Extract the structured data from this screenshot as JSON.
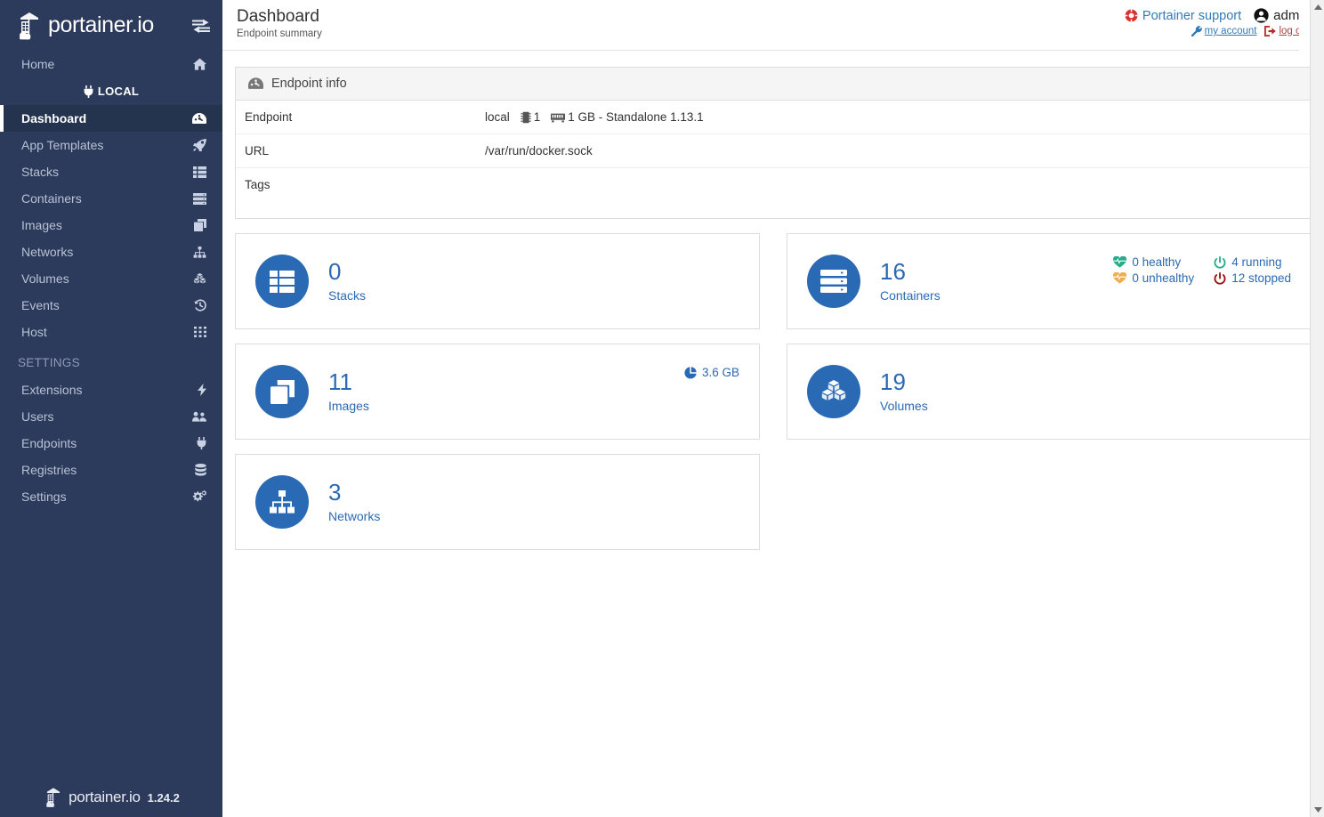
{
  "sidebar": {
    "brand": {
      "name": "portainer.io",
      "toggle_icon": "toggle-sidebar-icon",
      "logo_icon": "portainer-logo-icon"
    },
    "home": {
      "label": "Home",
      "icon": "home-icon"
    },
    "environment": {
      "label": "LOCAL",
      "icon": "plug-icon"
    },
    "items": [
      {
        "label": "Dashboard",
        "icon": "dashboard-icon",
        "active": true
      },
      {
        "label": "App Templates",
        "icon": "rocket-icon",
        "active": false
      },
      {
        "label": "Stacks",
        "icon": "list-icon",
        "active": false
      },
      {
        "label": "Containers",
        "icon": "server-icon",
        "active": false
      },
      {
        "label": "Images",
        "icon": "clone-icon",
        "active": false
      },
      {
        "label": "Networks",
        "icon": "sitemap-icon",
        "active": false
      },
      {
        "label": "Volumes",
        "icon": "cubes-icon",
        "active": false
      },
      {
        "label": "Events",
        "icon": "history-icon",
        "active": false
      },
      {
        "label": "Host",
        "icon": "th-icon",
        "active": false
      }
    ],
    "settings_title": "SETTINGS",
    "settings_items": [
      {
        "label": "Extensions",
        "icon": "bolt-icon"
      },
      {
        "label": "Users",
        "icon": "users-icon"
      },
      {
        "label": "Endpoints",
        "icon": "plug-icon"
      },
      {
        "label": "Registries",
        "icon": "database-icon"
      },
      {
        "label": "Settings",
        "icon": "cogs-icon"
      }
    ],
    "footer": {
      "name": "portainer.io",
      "version": "1.24.2",
      "logo_icon": "portainer-logo-icon"
    }
  },
  "header": {
    "title": "Dashboard",
    "subtitle": "Endpoint summary",
    "support_label": "Portainer support",
    "support_icon": "life-ring-icon",
    "username": "admin",
    "user_icon": "user-circle-icon",
    "my_account_label": "my account",
    "my_account_icon": "wrench-icon",
    "log_out_label": "log out",
    "log_out_icon": "sign-out-icon"
  },
  "endpoint_info": {
    "panel_title": "Endpoint info",
    "panel_icon": "tachometer-icon",
    "rows": [
      {
        "key": "Endpoint",
        "value": "local",
        "cpu_icon": "microchip-icon",
        "cpu": "1",
        "mem_icon": "memory-icon",
        "mem": "1 GB - Standalone 1.13.1"
      },
      {
        "key": "URL",
        "value": "/var/run/docker.sock"
      },
      {
        "key": "Tags",
        "value": ""
      }
    ]
  },
  "cards": [
    {
      "count": "0",
      "label": "Stacks",
      "icon": "stacks-icon",
      "position": "left"
    },
    {
      "count": "16",
      "label": "Containers",
      "icon": "containers-icon",
      "position": "right",
      "stats": [
        {
          "text": "0 healthy",
          "icon": "heartbeat-icon",
          "color": "#23ae89"
        },
        {
          "text": "4 running",
          "icon": "power-icon",
          "color": "#23ae89"
        },
        {
          "text": "0 unhealthy",
          "icon": "heartbeat-icon",
          "color": "#f0ad4e"
        },
        {
          "text": "12 stopped",
          "icon": "power-icon",
          "color": "#a10b0b"
        }
      ]
    },
    {
      "count": "11",
      "label": "Images",
      "icon": "images-icon",
      "position": "left",
      "size": "3.6 GB",
      "size_icon": "pie-chart-icon"
    },
    {
      "count": "19",
      "label": "Volumes",
      "icon": "volumes-icon",
      "position": "right"
    },
    {
      "count": "3",
      "label": "Networks",
      "icon": "networks-icon",
      "position": "left"
    }
  ],
  "colors": {
    "sidebar_bg": "#2c3b5b",
    "accent_blue": "#2a6ab4",
    "link_blue": "#337ab7",
    "danger_red": "#a94442",
    "healthy_green": "#23ae89",
    "warning_orange": "#f0ad4e",
    "stopped_red": "#a10b0b"
  },
  "scrollbar": {
    "up_icon": "scroll-up-arrow-icon",
    "down_icon": "scroll-down-arrow-icon"
  }
}
